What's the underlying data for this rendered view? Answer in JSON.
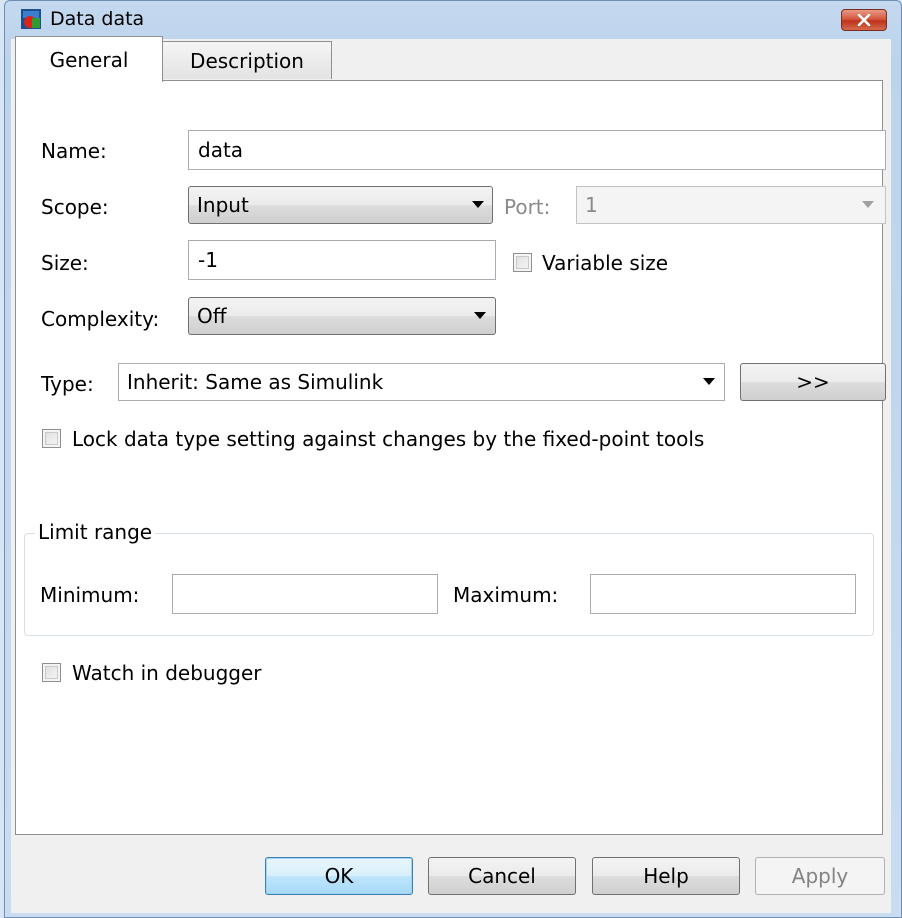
{
  "window": {
    "title": "Data data"
  },
  "tabs": [
    {
      "label": "General"
    },
    {
      "label": "Description"
    }
  ],
  "general": {
    "name_label": "Name:",
    "name_value": "data",
    "scope_label": "Scope:",
    "scope_value": "Input",
    "port_label": "Port:",
    "port_value": "1",
    "size_label": "Size:",
    "size_value": "-1",
    "variable_size_label": "Variable size",
    "complexity_label": "Complexity:",
    "complexity_value": "Off",
    "type_label": "Type:",
    "type_value": "Inherit: Same as Simulink",
    "type_assistant_label": ">>",
    "lock_label": "Lock data type setting against changes by the fixed-point tools",
    "limit_range_title": "Limit range",
    "minimum_label": "Minimum:",
    "minimum_value": "",
    "maximum_label": "Maximum:",
    "maximum_value": "",
    "watch_label": "Watch in debugger"
  },
  "buttons": {
    "ok": "OK",
    "cancel": "Cancel",
    "help": "Help",
    "apply": "Apply"
  },
  "colors": {
    "window_frame": "#c4d9ef",
    "close_button": "#c7422a",
    "default_button": "#bee6fd"
  }
}
